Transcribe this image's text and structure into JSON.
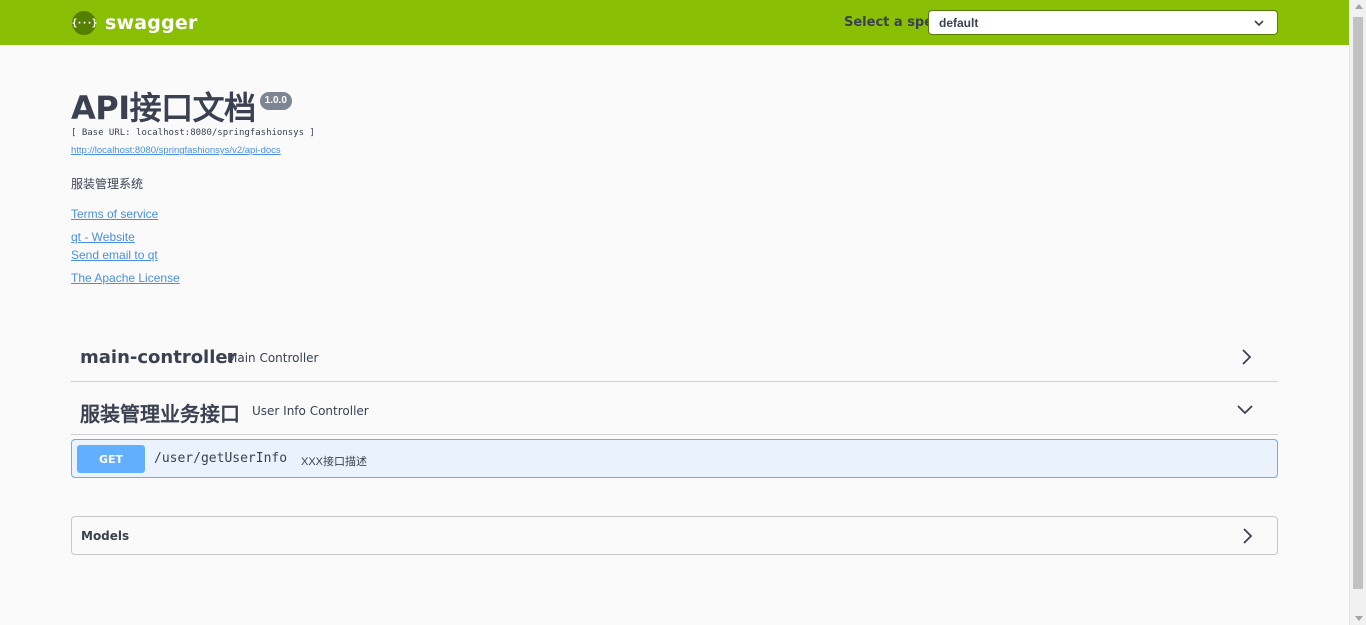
{
  "topbar": {
    "logo_mark": "{···}",
    "logo_text": "swagger",
    "spec_label": "Select a spec",
    "spec_value": "default"
  },
  "info": {
    "title": "API接口文档",
    "version": "1.0.0",
    "base_url": "[ Base URL: localhost:8080/springfashionsys ]",
    "docs_url": "http://localhost:8080/springfashionsys/v2/api-docs",
    "description": "服装管理系统",
    "terms_label": "Terms of service",
    "website_label": "qt - Website",
    "email_label": "Send email to qt",
    "license_label": "The Apache License"
  },
  "tags": [
    {
      "name": "main-controller",
      "description": "Main Controller"
    },
    {
      "name": "服装管理业务接口",
      "description": "User Info Controller"
    }
  ],
  "operation": {
    "method": "GET",
    "path": "/user/getUserInfo",
    "summary": "XXX接口描述"
  },
  "models": {
    "label": "Models"
  },
  "colors": {
    "topbar": "#89bf04",
    "get_method": "#61affe",
    "link": "#4990e2",
    "text": "#3b4151"
  }
}
